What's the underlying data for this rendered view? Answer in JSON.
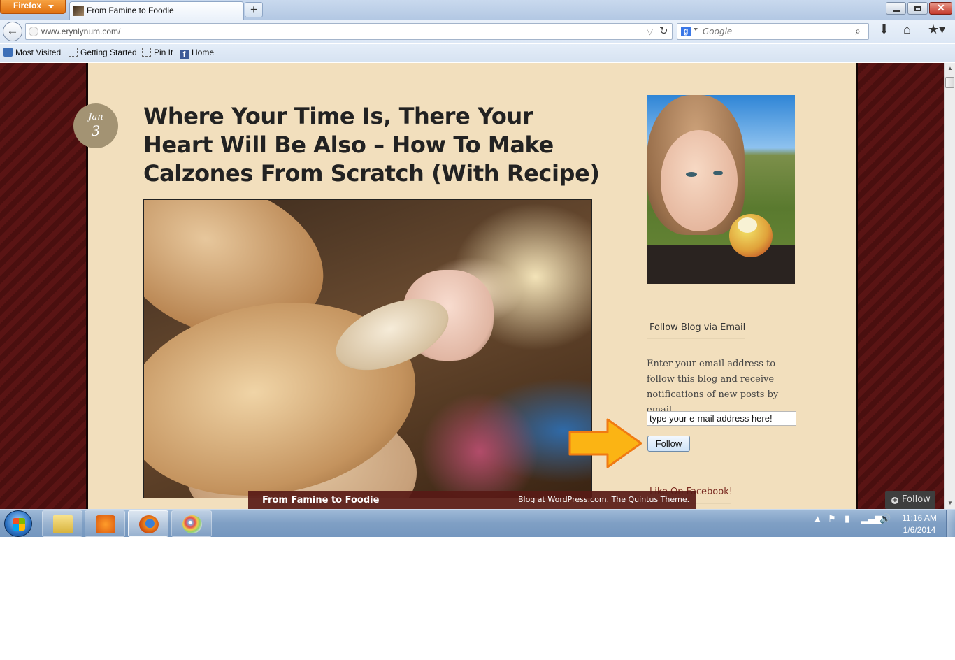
{
  "browser": {
    "menu_label": "Firefox",
    "tab_title": "From Famine to Foodie",
    "new_tab": "+",
    "url": "www.erynlynum.com/",
    "search_engine": "Google",
    "search_placeholder": "Google",
    "bookmarks": [
      {
        "label": "Most Visited",
        "icon": "most-visited-icon"
      },
      {
        "label": "Getting Started",
        "icon": "page-icon"
      },
      {
        "label": "Pin It",
        "icon": "page-icon"
      },
      {
        "label": "Home",
        "icon": "facebook-icon"
      }
    ]
  },
  "post": {
    "date_month": "Jan",
    "date_day": "3",
    "title": "Where Your Time Is, There Your Heart Will Be Also – How To Make Calzones From Scratch (With Recipe)"
  },
  "sidebar": {
    "follow_title": "Follow Blog via Email",
    "follow_description": "Enter your email address to follow this blog and receive notifications of new posts by email.",
    "email_value": "type your e-mail address here!",
    "follow_button": "Follow",
    "facebook_title": "Like On Facebook!"
  },
  "footer": {
    "site_name": "From Famine to Foodie",
    "credit": "Blog at WordPress.com. The Quintus Theme."
  },
  "wp_follow": {
    "label": "Follow"
  },
  "taskbar": {
    "time": "11:16 AM",
    "date": "1/6/2014",
    "apps": [
      "windows-explorer-icon",
      "media-player-icon",
      "firefox-icon",
      "paint-icon"
    ]
  },
  "colors": {
    "page_bg": "#f2dfbd",
    "background_stripes": "#5a1414",
    "footer_bar": "#581a16",
    "arrow": "#fbb414",
    "firefox_orange": "#e0700f"
  }
}
